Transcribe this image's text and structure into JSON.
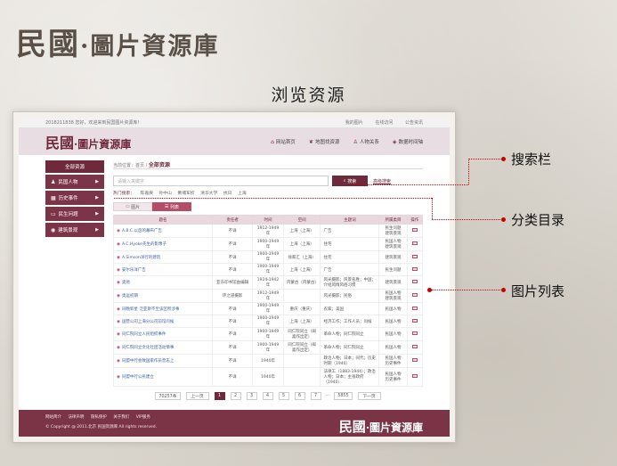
{
  "slide": {
    "logo_big": "民國",
    "logo_rest": "·圖片資源庫",
    "title": "浏览资源"
  },
  "site": {
    "topbar": {
      "welcome": "2018211838 您好，欢迎来到民国图片资源库！",
      "links": [
        "我的图片",
        "在线访问",
        "公告资讯"
      ]
    },
    "brand_big": "民國",
    "brand_rest": "·圖片資源庫",
    "nav": [
      {
        "icon": "home-icon",
        "glyph": "⌂",
        "label": "网站首页"
      },
      {
        "icon": "bird-icon",
        "glyph": "❦",
        "label": "地图找资源"
      },
      {
        "icon": "person-icon",
        "glyph": "♙",
        "label": "人物关系"
      },
      {
        "icon": "pin-icon",
        "glyph": "◈",
        "label": "数据时间轴"
      }
    ],
    "sidebar": {
      "head": "全部资源",
      "items": [
        {
          "icon": "person-icon",
          "glyph": "♟",
          "label": "民国人物"
        },
        {
          "icon": "calendar-icon",
          "glyph": "▦",
          "label": "历史事件"
        },
        {
          "icon": "monitor-icon",
          "glyph": "▭",
          "label": "民生问题"
        },
        {
          "icon": "camera-icon",
          "glyph": "◉",
          "label": "建筑景观"
        }
      ]
    },
    "crumb_prefix": "当前位置：首页 /",
    "crumb_current": "全部资源",
    "search": {
      "placeholder": "请输入关键字",
      "button": "搜索",
      "advanced": "高级搜索"
    },
    "categories": [
      "热门搜索：",
      "陈嘉庚",
      "孙中山",
      "黄埔军校",
      "清华大学",
      "抗日",
      "上海"
    ],
    "view_tabs": [
      "图片",
      "列表"
    ],
    "table": {
      "headers": [
        "题名",
        "责任者",
        "时间",
        "空间",
        "主题词",
        "所属类目",
        "操作"
      ],
      "rows": [
        {
          "title": "A.B.C.以后的幕布广告",
          "author": "不详",
          "time": "1912-1949年",
          "place": "上海（上海）",
          "subject": "广告",
          "category": "民生问题\n建筑景观"
        },
        {
          "title": "A.C.Hyoke先生的影像子",
          "author": "不详",
          "time": "1900-1949年",
          "place": "上海（上海）",
          "subject": "住宅",
          "category": "民国人物\n建筑景观"
        },
        {
          "title": "A.Simson洋行的建筑",
          "author": "不详",
          "time": "1900-1949年",
          "place": "徐家汇（上海）",
          "subject": "住宅",
          "category": "建筑景观"
        },
        {
          "title": "安尔乐洋广告",
          "author": "不详",
          "time": "1900-1949年",
          "place": "上海（上海）",
          "subject": "广告",
          "category": "民生问题"
        },
        {
          "title": "奥地",
          "author": "亚东印书馆由编辑",
          "time": "1924-1942年",
          "place": "内蒙古（内蒙古）",
          "subject": "风光摄影；风景名胜；中国；介绍风情风俗习惯",
          "category": "建筑景观"
        },
        {
          "title": "奥运初期",
          "author": "环之道摄影",
          "time": "1912-1949年",
          "place": "",
          "subject": "风光摄影；民俗",
          "category": "民国人物\n建筑景观"
        },
        {
          "title": "同晚新星 泛亚斯不至该区所涉事",
          "author": "不详",
          "time": "1900-1949年",
          "place": "重庆（重庆）",
          "subject": "农家；美国",
          "category": "民国人物"
        },
        {
          "title": "国营公司上海分公司前馆问候",
          "author": "不详",
          "time": "1900-1949年",
          "place": "上海（上海）",
          "subject": "经济工作；工作人员；问候",
          "category": "民国人物"
        },
        {
          "title": "同仁院同立人民组织事件",
          "author": "不详",
          "time": "1900-1949年",
          "place": "同仁院同立（闽喜作出定）",
          "subject": "革命人物；同仁院同立",
          "category": "民国人物"
        },
        {
          "title": "同仁院同立文化社团活动情事",
          "author": "不详",
          "time": "1900-1949年",
          "place": "同仁院同立（闽喜作出定）",
          "subject": "革命人物；同仁院同立",
          "category": "民国人物"
        },
        {
          "title": "同盟中行会致国家作员普志上",
          "author": "不详",
          "time": "1940年",
          "place": "",
          "subject": "政治人物；日本；同代；历史时期（1940）",
          "category": "民国人物\n历史事件"
        },
        {
          "title": "同盟中行公民建立",
          "author": "不详",
          "time": "1940年",
          "place": "",
          "subject": "法律工（1883-1944）；政治人物；日本；主张政府（1940）",
          "category": "民国人物\n历史事件"
        }
      ]
    },
    "pager": {
      "total": "70257条",
      "prev": "上一页",
      "pages": [
        "1",
        "2",
        "3",
        "4",
        "5",
        "6",
        "7"
      ],
      "ellipsis": "...",
      "last": "5855",
      "next": "下一页",
      "current": "1"
    },
    "footer": {
      "links": [
        "网站简介",
        "法律声明",
        "隐私保护",
        "关于我们",
        "VIP服务"
      ],
      "copyright": "© Copyright @ 2011.北京 民国资源库 All rights reserved.",
      "brand_big": "民國",
      "brand_rest": "·圖片資源庫"
    }
  },
  "callouts": {
    "search": "搜索栏",
    "categories": "分类目录",
    "list": "图片列表"
  },
  "colors": {
    "accent": "#6e2a3a",
    "callout_line": "#cc0000"
  }
}
